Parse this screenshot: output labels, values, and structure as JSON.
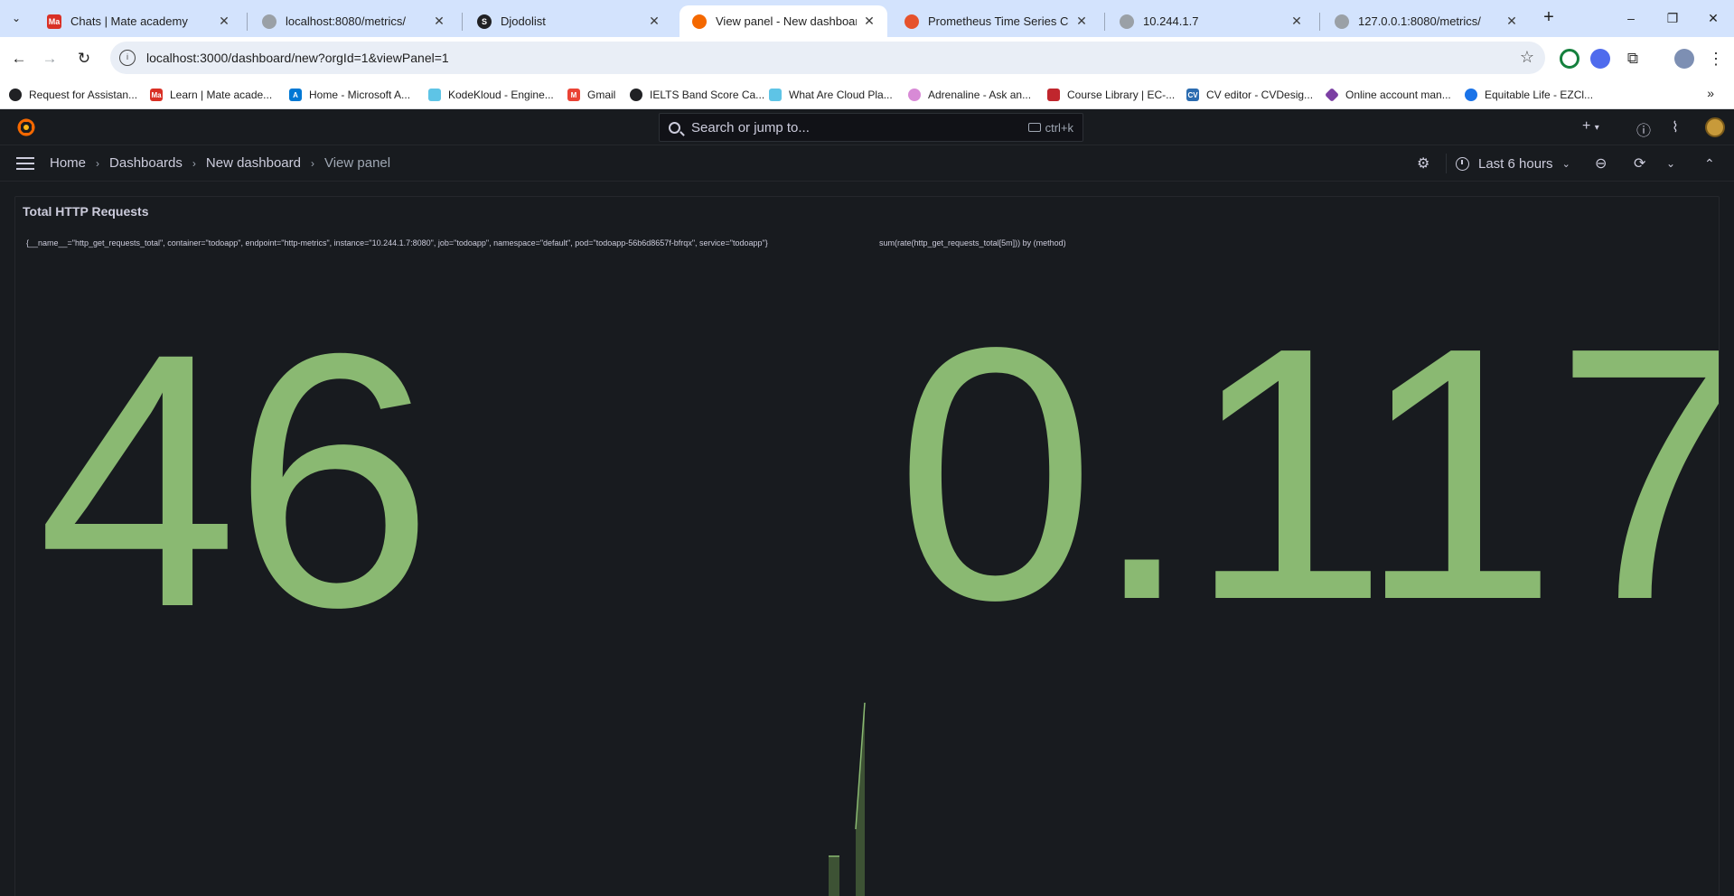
{
  "browser": {
    "tabs": [
      {
        "title": "Chats | Mate academy",
        "favicon": "mate-icon",
        "color": "#d93025",
        "active": false
      },
      {
        "title": "localhost:8080/metrics/",
        "favicon": "globe-icon",
        "color": "#9aa0a6",
        "active": false
      },
      {
        "title": "Djodolist",
        "favicon": "s-icon",
        "color": "#202124",
        "active": false
      },
      {
        "title": "View panel - New dashboard - ",
        "favicon": "grafana-icon",
        "color": "#f46800",
        "active": true
      },
      {
        "title": "Prometheus Time Series Collect",
        "favicon": "prometheus-icon",
        "color": "#e6522c",
        "active": false
      },
      {
        "title": "10.244.1.7",
        "favicon": "globe-icon",
        "color": "#9aa0a6",
        "active": false
      },
      {
        "title": "127.0.0.1:8080/metrics/",
        "favicon": "globe-icon",
        "color": "#9aa0a6",
        "active": false
      }
    ],
    "url": "localhost:3000/dashboard/new?orgId=1&viewPanel=1",
    "bookmarks": [
      {
        "label": "Request for Assistan...",
        "color": "#202124"
      },
      {
        "label": "Learn | Mate acade...",
        "color": "#d93025"
      },
      {
        "label": "Home - Microsoft A...",
        "color": "#0078d4"
      },
      {
        "label": "KodeKloud - Engine...",
        "color": "#5ec4e6"
      },
      {
        "label": "Gmail",
        "color": "#ea4335"
      },
      {
        "label": "IELTS Band Score Ca...",
        "color": "#202124"
      },
      {
        "label": "What Are Cloud Pla...",
        "color": "#5ec4e6"
      },
      {
        "label": "Adrenaline - Ask an...",
        "color": "#d88ad6"
      },
      {
        "label": "Course Library | EC-...",
        "color": "#c0262d"
      },
      {
        "label": "CV editor - CVDesig...",
        "color": "#2b6cb0"
      },
      {
        "label": "Online account man...",
        "color": "#7b3fa3"
      },
      {
        "label": "Equitable Life - EZCl...",
        "color": "#1a73e8"
      }
    ],
    "window_controls": {
      "minimize": "–",
      "restore": "❐",
      "close": "✕"
    }
  },
  "grafana": {
    "search": {
      "placeholder": "Search or jump to...",
      "shortcut": "ctrl+k"
    },
    "breadcrumbs": [
      "Home",
      "Dashboards",
      "New dashboard",
      "View panel"
    ],
    "time_range": "Last 6 hours",
    "panel": {
      "title": "Total HTTP Requests",
      "stats": [
        {
          "label": "{__name__=\"http_get_requests_total\", container=\"todoapp\", endpoint=\"http-metrics\", instance=\"10.244.1.7:8080\", job=\"todoapp\", namespace=\"default\", pod=\"todoapp-56b6d8657f-bfrqx\", service=\"todoapp\"}",
          "value": "46"
        },
        {
          "label": "sum(rate(http_get_requests_total[5m])) by (method)",
          "value": "0.117"
        }
      ],
      "color": "#8ab972"
    }
  }
}
